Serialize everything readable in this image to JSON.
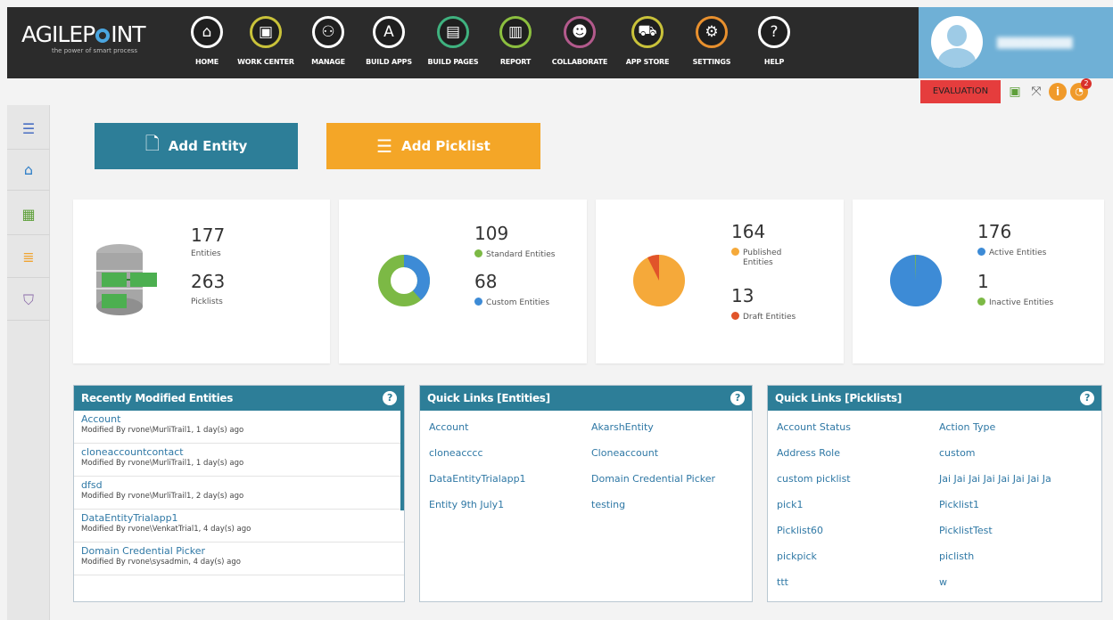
{
  "logo": {
    "pre": "AGILEP",
    "post": "INT",
    "tagline": "the power of smart process"
  },
  "nav": [
    {
      "label": "HOME",
      "icon": "home-icon",
      "glyph": "⌂",
      "color": "#ffffff"
    },
    {
      "label": "WORK CENTER",
      "icon": "work-center-icon",
      "glyph": "▣",
      "color": "#c9c23a"
    },
    {
      "label": "MANAGE",
      "icon": "manage-icon",
      "glyph": "⚇",
      "color": "#ffffff"
    },
    {
      "label": "BUILD APPS",
      "icon": "build-apps-icon",
      "glyph": "A",
      "color": "#ffffff"
    },
    {
      "label": "BUILD PAGES",
      "icon": "build-pages-icon",
      "glyph": "▤",
      "color": "#3fb27f"
    },
    {
      "label": "REPORT",
      "icon": "report-icon",
      "glyph": "▥",
      "color": "#8cbf3f"
    },
    {
      "label": "COLLABORATE",
      "icon": "collaborate-icon",
      "glyph": "☻",
      "color": "#b35a8c"
    },
    {
      "label": "APP STORE",
      "icon": "app-store-icon",
      "glyph": "⛟",
      "color": "#c9c23a"
    },
    {
      "label": "SETTINGS",
      "icon": "settings-icon",
      "glyph": "⚙",
      "color": "#e8902e"
    },
    {
      "label": "HELP",
      "icon": "help-icon",
      "glyph": "?",
      "color": "#ffffff"
    }
  ],
  "status": {
    "evaluation": "EVALUATION",
    "notifications": "2"
  },
  "actions": {
    "add_entity": "Add Entity",
    "add_picklist": "Add Picklist"
  },
  "stats": {
    "entities_count": "177",
    "entities_label": "Entities",
    "picklists_count": "263",
    "picklists_label": "Picklists",
    "standard_count": "109",
    "standard_label": "Standard Entities",
    "custom_count": "68",
    "custom_label": "Custom Entities",
    "published_count": "164",
    "published_label_1": "Published",
    "published_label_2": "Entities",
    "draft_count": "13",
    "draft_label": "Draft Entities",
    "active_count": "176",
    "active_label": "Active Entities",
    "inactive_count": "1",
    "inactive_label": "Inactive Entities"
  },
  "colors": {
    "green": "#7cb945",
    "blue": "#3d8bd6",
    "orange": "#f5a93a",
    "red": "#e1542a"
  },
  "recent": {
    "title": "Recently Modified Entities",
    "items": [
      {
        "name": "Account",
        "by": "Modified By rvone\\MurliTrail1, 1 day(s) ago"
      },
      {
        "name": "cloneaccountcontact",
        "by": "Modified By rvone\\MurliTrail1, 1 day(s) ago"
      },
      {
        "name": "dfsd",
        "by": "Modified By rvone\\MurliTrail1, 2 day(s) ago"
      },
      {
        "name": "DataEntityTrialapp1",
        "by": "Modified By rvone\\VenkatTrial1, 4 day(s) ago"
      },
      {
        "name": "Domain Credential Picker",
        "by": "Modified By rvone\\sysadmin, 4 day(s) ago"
      }
    ]
  },
  "quick_entities": {
    "title": "Quick Links [Entities]",
    "col1": [
      "Account",
      "cloneacccc",
      "DataEntityTrialapp1",
      "Entity 9th July1"
    ],
    "col2": [
      "AkarshEntity",
      "Cloneaccount",
      "Domain Credential Picker",
      "testing"
    ]
  },
  "quick_picklists": {
    "title": "Quick Links [Picklists]",
    "col1": [
      "Account Status",
      "Address Role",
      "custom picklist",
      "pick1",
      "Picklist60",
      "pickpick",
      "ttt"
    ],
    "col2": [
      "Action Type",
      "custom",
      "Jai Jai Jai Jai Jai Jai Jai Ja",
      "Picklist1",
      "PicklistTest",
      "piclisth",
      "w"
    ]
  }
}
